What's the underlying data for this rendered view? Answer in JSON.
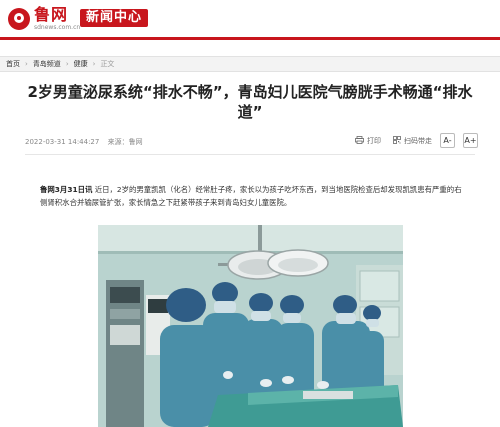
{
  "site": {
    "logo_name": "鲁网",
    "logo_domain": "sdnews.com.cn",
    "channel": "新闻中心"
  },
  "breadcrumb": {
    "items": [
      "首页",
      "青岛频道",
      "健康"
    ],
    "current": "正文",
    "separator": "›"
  },
  "article": {
    "title": "2岁男童泌尿系统“排水不畅”，青岛妇儿医院气膀胱手术畅通“排水道”",
    "datetime": "2022-03-31 14:44:27",
    "source": "来源：鲁网",
    "lead_bold": "鲁网3月31日讯",
    "lead_text": " 近日，2岁的男童凯凯（化名）经常肚子疼，家长以为孩子吃坏东西，到当地医院检查后却发现凯凯患有严重的右侧肾积水合并输尿管扩张，家长情急之下赶紧带孩子来到青岛妇女儿童医院。"
  },
  "tools": {
    "print_label": "打印",
    "scan_label": "扫码带走",
    "font_small": "A-",
    "font_large": "A+"
  },
  "colors": {
    "brand_red": "#c8161d",
    "photo_scrubs": "#4a8fa8",
    "photo_wall": "#b9d3cf"
  },
  "icons": {
    "print": "printer-icon",
    "scan": "qr-code-icon"
  }
}
